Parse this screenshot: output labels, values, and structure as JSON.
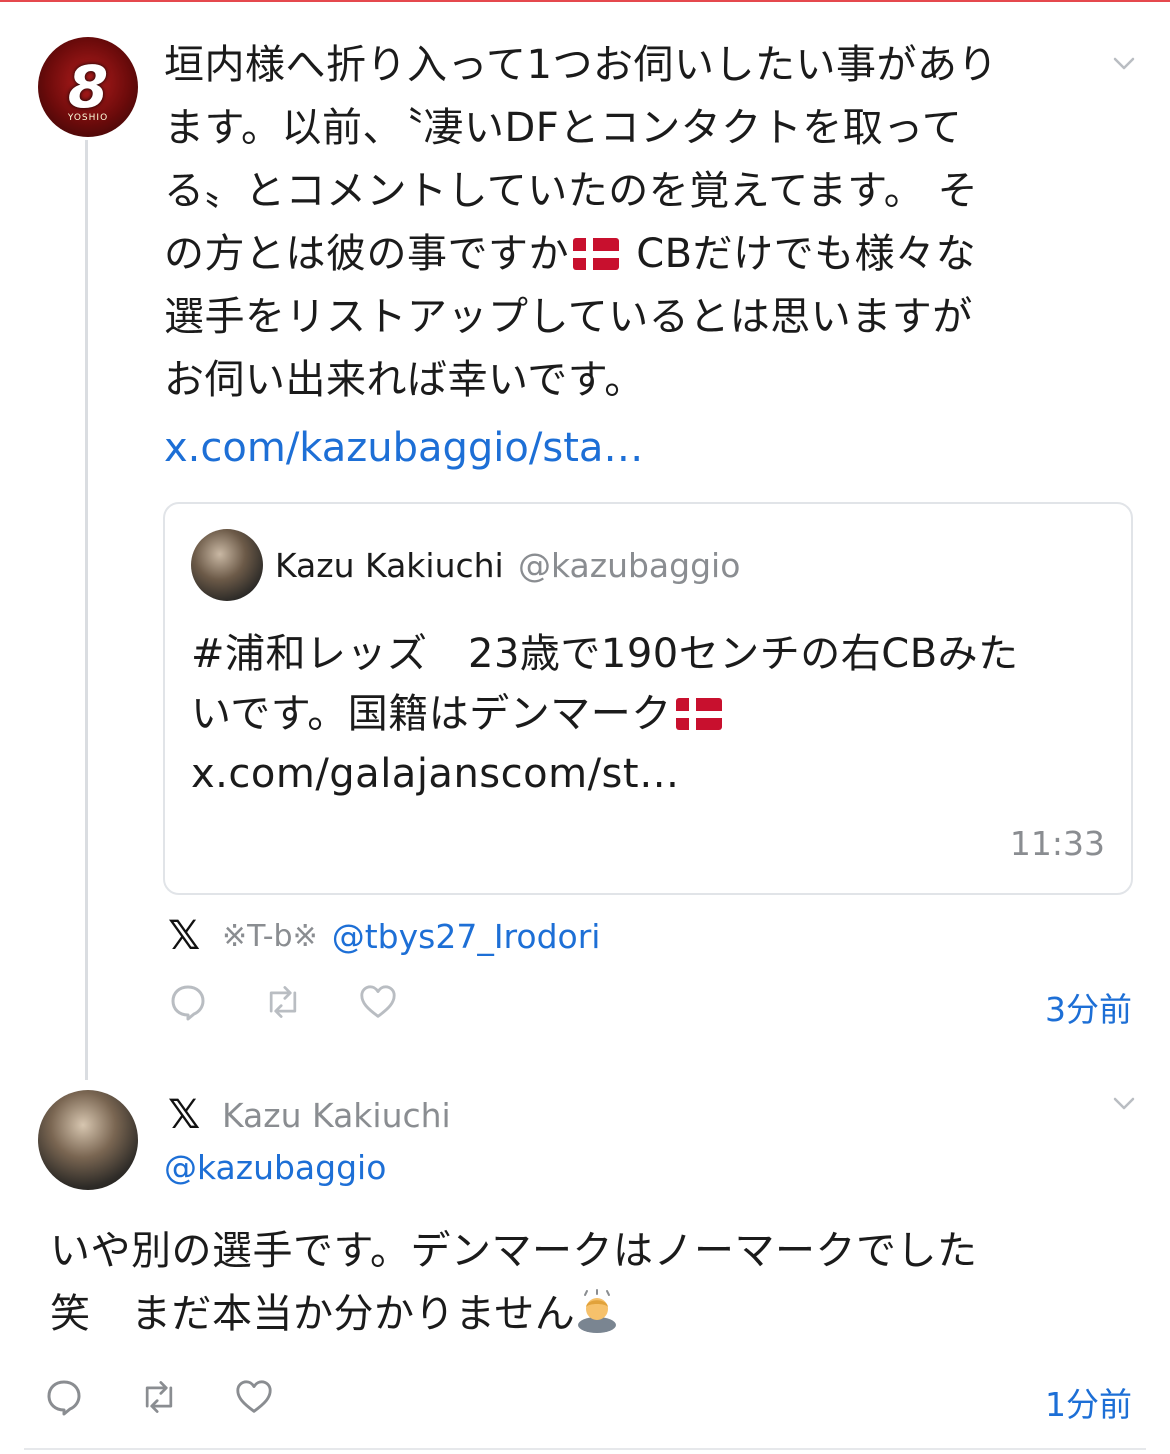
{
  "tweet1": {
    "avatar_text": "8",
    "avatar_caption": "YOSHIO",
    "body_line1": "垣内様へ折り入って1つお伺いしたい事があり",
    "body_line2": "ます。以前、〝凄いDFとコンタクトを取って",
    "body_line3": "る〟とコメントしていたのを覚えてます。 そ",
    "body_line4a": "の方とは彼の事ですか",
    "body_line4b": " CBだけでも様々な",
    "body_line5": "選手をリストアップしているとは思いますが",
    "body_line6": "お伺い出来れば幸いです。",
    "link": "x.com/kazubaggio/sta…",
    "quote": {
      "name": "Kazu Kakiuchi",
      "handle": "@kazubaggio",
      "line1": "#浦和レッズ　23歳で190センチの右CBみた",
      "line2": "いです。国籍はデンマーク",
      "link": "x.com/galajanscom/st…",
      "time": "11:33"
    },
    "via_name": "※T-b※",
    "via_handle": "@tbys27_Irodori",
    "time_ago": "3分前"
  },
  "tweet2": {
    "name": "Kazu Kakiuchi",
    "handle": "@kazubaggio",
    "line1": "いや別の選手です。デンマークはノーマークでした",
    "line2": "笑　まだ本当か分かりません",
    "time_ago": "1分前"
  },
  "icons": {
    "platform": "x-logo",
    "flag": "denmark-flag-emoji",
    "bow": "bowing-person-emoji",
    "reply": "reply-icon",
    "retweet": "retweet-icon",
    "like": "heart-icon",
    "menu": "chevron-down-icon"
  },
  "colors": {
    "link": "#1d6fd6",
    "muted": "#8a8d91",
    "border": "#e1e4e8",
    "accent_top": "#e5484d"
  }
}
